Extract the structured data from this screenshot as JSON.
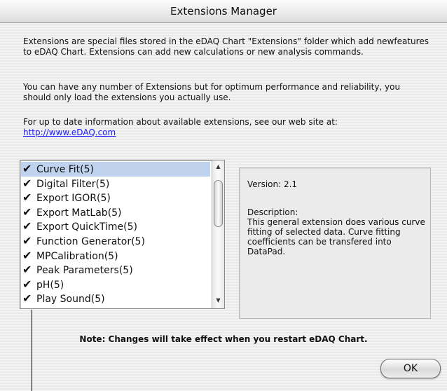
{
  "window": {
    "title": "Extensions Manager"
  },
  "intro": {
    "p1": "Extensions are special files stored in the eDAQ Chart \"Extensions\" folder which add newfeatures to eDAQ Chart. Extensions can add new calculations or new analysis commands.",
    "p2": "You can have any number of Extensions but for optimum performance and reliability, you should only load the extensions you actually use.",
    "p3": "For up to date information about available extensions, see our web site at:",
    "link": "http://www.eDAQ.com"
  },
  "extensions": {
    "items": [
      {
        "label": "Curve Fit(5)",
        "checked": true,
        "selected": true
      },
      {
        "label": "Digital Filter(5)",
        "checked": true,
        "selected": false
      },
      {
        "label": "Export IGOR(5)",
        "checked": true,
        "selected": false
      },
      {
        "label": "Export MatLab(5)",
        "checked": true,
        "selected": false
      },
      {
        "label": "Export QuickTime(5)",
        "checked": true,
        "selected": false
      },
      {
        "label": "Function Generator(5)",
        "checked": true,
        "selected": false
      },
      {
        "label": "MPCalibration(5)",
        "checked": true,
        "selected": false
      },
      {
        "label": "Peak Parameters(5)",
        "checked": true,
        "selected": false
      },
      {
        "label": "pH(5)",
        "checked": true,
        "selected": false
      },
      {
        "label": "Play Sound(5)",
        "checked": true,
        "selected": false
      }
    ],
    "check_glyph": "✔",
    "selected_color": "#bfd3ef"
  },
  "details": {
    "version": "Version: 2.1",
    "description_label": "Description:",
    "description": "This general extension does various curve fitting of selected data. Curve fitting coefficients can be transfered into DataPad."
  },
  "note": "Note: Changes will take effect when you restart eDAQ Chart.",
  "buttons": {
    "ok": "OK"
  },
  "scrollbar": {
    "up_icon": "▲",
    "down_icon": "▼"
  },
  "colors": {
    "link": "#1a1aff"
  }
}
